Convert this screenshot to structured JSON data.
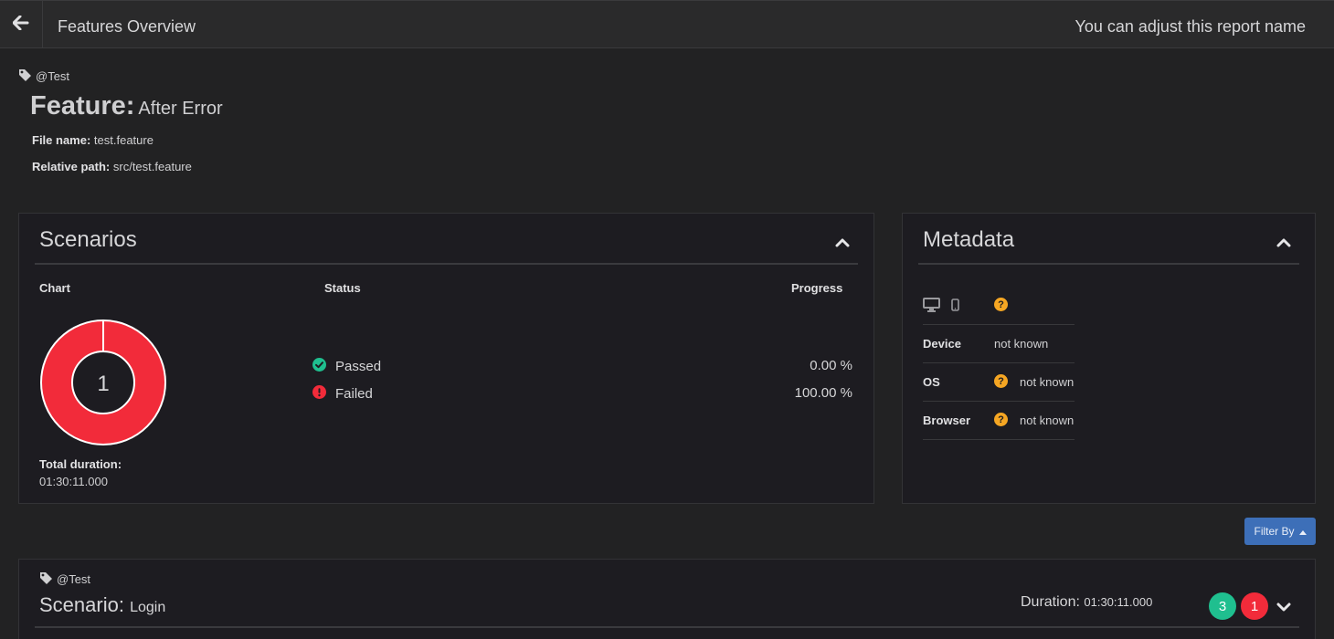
{
  "topbar": {
    "title": "Features Overview",
    "report_name": "You can adjust this report name"
  },
  "feature": {
    "tag": "@Test",
    "label": "Feature:",
    "name": "After Error",
    "file_name_label": "File name:",
    "file_name": "test.feature",
    "relative_path_label": "Relative path:",
    "relative_path": "src/test.feature"
  },
  "scenarios_panel": {
    "title": "Scenarios",
    "col_chart": "Chart",
    "col_status": "Status",
    "col_progress": "Progress",
    "donut_center": "1",
    "statuses": [
      {
        "label": "Passed",
        "percent": "0.00 %",
        "color": "#1fbf8f"
      },
      {
        "label": "Failed",
        "percent": "100.00 %",
        "color": "#f22b3a"
      }
    ],
    "total_duration_label": "Total duration:",
    "total_duration": "01:30:11.000"
  },
  "chart_data": {
    "type": "pie",
    "categories": [
      "Passed",
      "Failed"
    ],
    "values": [
      0,
      1
    ],
    "colors": [
      "#1fbf8f",
      "#f22b3a"
    ],
    "center_label": "1"
  },
  "metadata_panel": {
    "title": "Metadata",
    "device_label": "Device",
    "device_value": "not known",
    "os_label": "OS",
    "os_value": "not known",
    "browser_label": "Browser",
    "browser_value": "not known"
  },
  "filter": {
    "label": "Filter By"
  },
  "scenario": {
    "tag": "@Test",
    "label": "Scenario:",
    "name": "Login",
    "duration_label": "Duration:",
    "duration": "01:30:11.000",
    "passed_count": "3",
    "failed_count": "1",
    "passed_color": "#1fbf8f",
    "failed_color": "#f22b3a"
  }
}
